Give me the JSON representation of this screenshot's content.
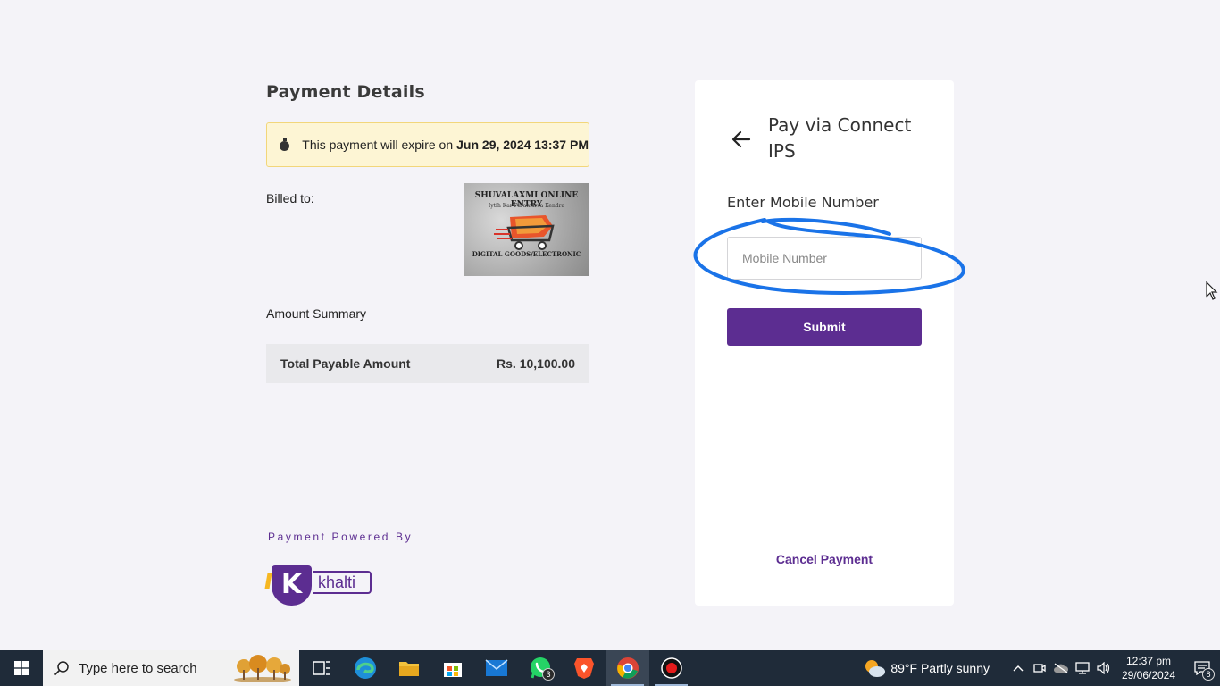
{
  "payment": {
    "title": "Payment Details",
    "expiry_text": "This payment will expire on",
    "expiry_date": "Jun 29, 2024 13:37 PM",
    "billed_to_label": "Billed to:",
    "merchant_logo": {
      "line1": "SHUVALAXMI ONLINE ENTRY",
      "line2": "Iytih Kar Paramarsa Kendra",
      "line3": "DIGITAL GOODS/ELECTRONIC"
    },
    "amount_summary_label": "Amount Summary",
    "total_label": "Total Payable Amount",
    "total_value": "Rs. 10,100.00",
    "powered_by": "Payment Powered By",
    "provider_mark": "K",
    "provider_name": "khalti"
  },
  "card": {
    "title": "Pay via Connect IPS",
    "mobile_label": "Enter Mobile Number",
    "mobile_placeholder": "Mobile Number",
    "mobile_value": "",
    "submit_label": "Submit",
    "cancel_label": "Cancel Payment"
  },
  "taskbar": {
    "search_placeholder": "Type here to search",
    "whatsapp_badge": "3",
    "weather": "89°F  Partly sunny",
    "time": "12:37 pm",
    "date": "29/06/2024",
    "notification_count": "8"
  },
  "colors": {
    "brand_purple": "#5c2d91",
    "expiry_bg": "#fdf5d4",
    "annotation_blue": "#1a73e8",
    "taskbar_bg": "#1f2b39"
  }
}
